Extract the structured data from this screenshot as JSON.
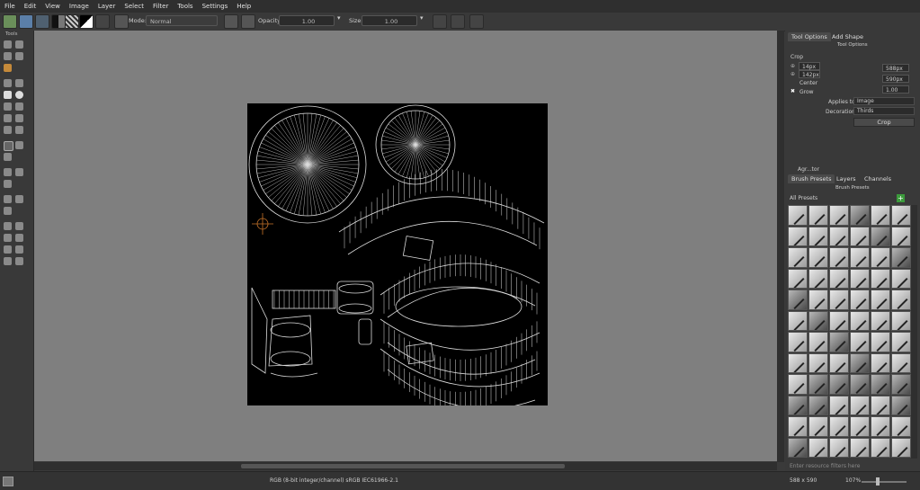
{
  "menu": [
    "File",
    "Edit",
    "View",
    "Image",
    "Layer",
    "Select",
    "Filter",
    "Tools",
    "Settings",
    "Help"
  ],
  "toolbar": {
    "mode_label": "Mode:",
    "mode_value": "Normal",
    "opacity_label": "Opacity:",
    "opacity_value": "1.00",
    "size_label": "Size:",
    "size_value": "1.00"
  },
  "toolbox": {
    "title": "Tools"
  },
  "tool_options": {
    "tabs": [
      "Tool Options",
      "Add Shape"
    ],
    "header": "Tool Options",
    "crop_label": "Crop",
    "x_value": "14px",
    "y_value": "142px",
    "width_value": "588px",
    "height_value": "590px",
    "ratio_value": "1.00",
    "center_label": "Center",
    "grow_label": "Grow",
    "applies_to_label": "Applies to:",
    "applies_to_value": "Image",
    "decoration_label": "Decoration:",
    "decoration_value": "Thirds",
    "crop_button": "Crop"
  },
  "brush_docker": {
    "title": "Agr...tor",
    "tabs": [
      "Brush Presets",
      "Layers",
      "Channels"
    ],
    "header": "Brush Presets",
    "filter_value": "All Presets",
    "search_placeholder": "Enter resource filters here"
  },
  "status": {
    "color_info": "RGB (8-bit integer/channel)  sRGB IEC61966-2.1",
    "dimensions": "588 x 590",
    "zoom": "107%"
  }
}
